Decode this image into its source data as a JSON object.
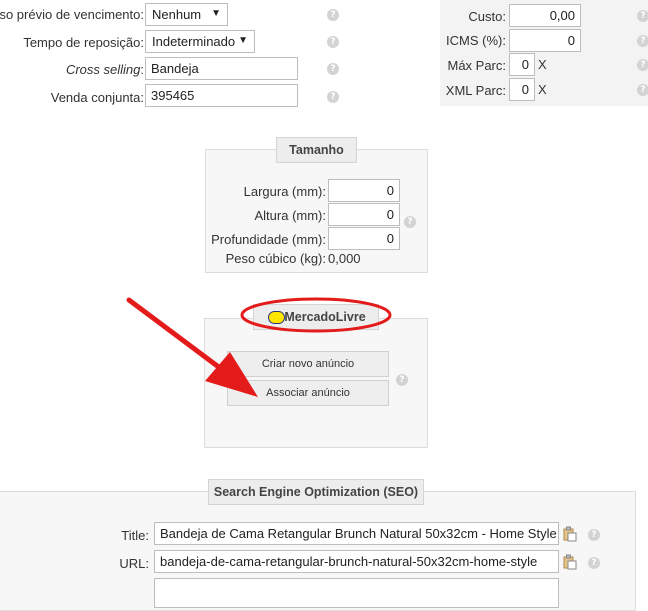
{
  "form": {
    "aviso": {
      "label": "iso prévio de vencimento:",
      "value": "Nenhum"
    },
    "reposicao": {
      "label": "Tempo de reposição:",
      "value": "Indeterminado"
    },
    "cross": {
      "label": "Cross selling",
      "suffix": ":",
      "value": "Bandeja"
    },
    "venda": {
      "label": "Venda conjunta:",
      "value": "395465"
    }
  },
  "pricing": {
    "custo": {
      "label": "Custo:",
      "value": "0,00"
    },
    "icms": {
      "label": "ICMS (%):",
      "value": "0"
    },
    "max_parc": {
      "label": "Máx Parc:",
      "value": "0",
      "suffix": "X"
    },
    "xml_parc": {
      "label": "XML Parc:",
      "value": "0",
      "suffix": "X"
    }
  },
  "tamanho": {
    "legend": "Tamanho",
    "largura": {
      "label": "Largura (mm):",
      "value": "0"
    },
    "altura": {
      "label": "Altura (mm):",
      "value": "0"
    },
    "profundidade": {
      "label": "Profundidade (mm):",
      "value": "0"
    },
    "peso": {
      "label": "Peso cúbico (kg):",
      "value": "0,000"
    }
  },
  "mercadolivre": {
    "legend": "MercadoLivre",
    "criar_label": "Criar novo anúncio",
    "associar_label": "Associar anúncio"
  },
  "seo": {
    "legend": "Search Engine Optimization (SEO)",
    "title": {
      "label": "Title:",
      "value": "Bandeja de Cama Retangular Brunch Natural 50x32cm - Home Style"
    },
    "url": {
      "label": "URL:",
      "value": "bandeja-de-cama-retangular-brunch-natural-50x32cm-home-style"
    },
    "description": {
      "value": ""
    }
  },
  "help_glyph": "?",
  "colors": {
    "annotation_red": "#e41b1b",
    "ml_yellow": "#ffe600"
  }
}
